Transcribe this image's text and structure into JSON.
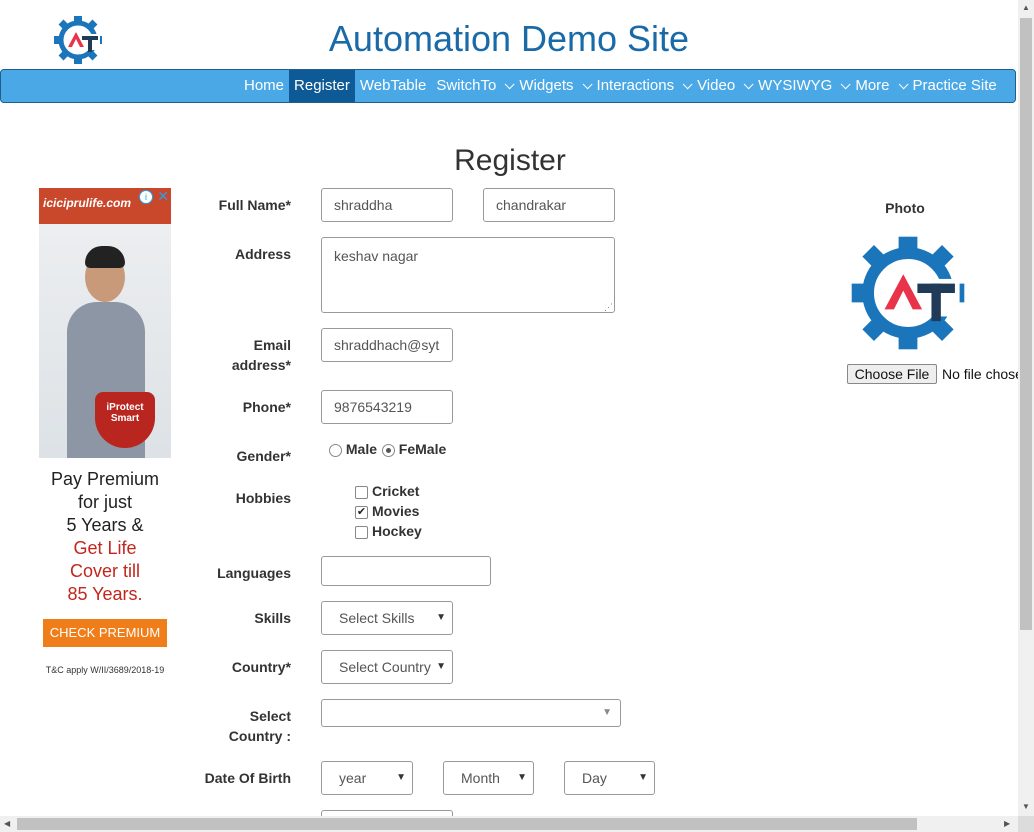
{
  "header": {
    "site_title": "Automation Demo Site",
    "nav": [
      {
        "label": "Home",
        "dropdown": false,
        "active": false
      },
      {
        "label": "Register",
        "dropdown": false,
        "active": true
      },
      {
        "label": "WebTable",
        "dropdown": false,
        "active": false
      },
      {
        "label": "SwitchTo",
        "dropdown": true,
        "active": false
      },
      {
        "label": "Widgets",
        "dropdown": true,
        "active": false
      },
      {
        "label": "Interactions",
        "dropdown": true,
        "active": false
      },
      {
        "label": "Video",
        "dropdown": true,
        "active": false
      },
      {
        "label": "WYSIWYG",
        "dropdown": true,
        "active": false
      },
      {
        "label": "More",
        "dropdown": true,
        "active": false
      },
      {
        "label": "Practice Site",
        "dropdown": false,
        "active": false
      }
    ]
  },
  "page_heading": "Register",
  "ad": {
    "brand": "iciciprulife.com",
    "badge": "iProtect Smart",
    "line1": "Pay Premium",
    "line2": "for just",
    "line3": "5 Years &",
    "line4": "Get Life",
    "line5": "Cover till",
    "line6": "85 Years.",
    "cta": "CHECK PREMIUM",
    "tc": "T&C apply W/II/3689/2018-19",
    "info_icon": "i",
    "close_icon": "✕"
  },
  "form": {
    "full_name_label": "Full Name*",
    "first_name_value": "shraddha",
    "last_name_value": "chandrakar",
    "address_label": "Address",
    "address_value": "keshav nagar",
    "email_label_1": "Email",
    "email_label_2": "address*",
    "email_value": "shraddhach@syt",
    "phone_label": "Phone*",
    "phone_value": "9876543219",
    "gender_label": "Gender*",
    "gender_options": [
      "Male",
      "FeMale"
    ],
    "gender_selected": "FeMale",
    "hobbies_label": "Hobbies",
    "hobbies": [
      {
        "label": "Cricket",
        "checked": false
      },
      {
        "label": "Movies",
        "checked": true
      },
      {
        "label": "Hockey",
        "checked": false
      }
    ],
    "languages_label": "Languages",
    "languages_value": "",
    "skills_label": "Skills",
    "skills_value": "Select Skills",
    "country_label": "Country*",
    "country_value": "Select Country",
    "select_country_label_1": "Select",
    "select_country_label_2": "Country :",
    "select_country_value": "",
    "dob_label": "Date Of Birth",
    "dob_year": "year",
    "dob_month": "Month",
    "dob_day": "Day"
  },
  "photo": {
    "label": "Photo",
    "choose_file": "Choose File",
    "file_status": "No file chosen"
  },
  "colors": {
    "navbar": "#4aa8e6",
    "nav_active": "#0e5a96",
    "title": "#1a6aa8",
    "logo_blue": "#1b75bb",
    "logo_red": "#e8334a",
    "logo_dark": "#1f3b57"
  }
}
